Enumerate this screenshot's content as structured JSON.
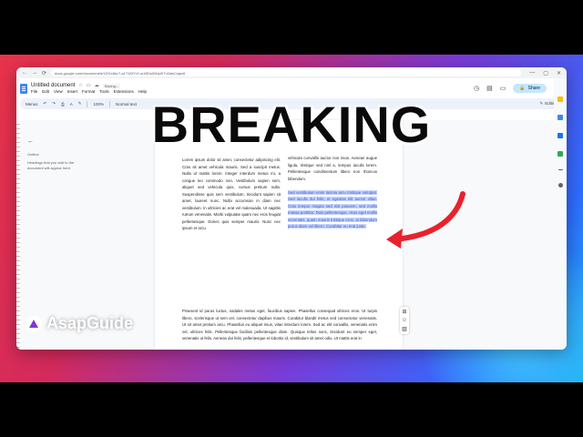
{
  "browser": {
    "url": "docs.google.com/document/d/1DGx8kcT-a1T1KfYrX-w1BDs00hjdXTvNdsCsjwdt",
    "nav_back": "←",
    "nav_forward": "→",
    "nav_reload": "⟳",
    "window_controls": [
      "—",
      "▢",
      "✕"
    ]
  },
  "doc": {
    "title": "Untitled document",
    "saving": "Saving...",
    "star": "☆",
    "move": "▭",
    "cloud": "☁",
    "menu": [
      "File",
      "Edit",
      "View",
      "Insert",
      "Format",
      "Tools",
      "Extensions",
      "Help"
    ],
    "history_icon": "◷",
    "comment_icon": "▤",
    "meet_icon": "▭",
    "share_label": "Share",
    "share_lock": "🔒"
  },
  "toolbar": {
    "menus": "Menus",
    "undo": "↶",
    "redo": "↷",
    "print": "⎙",
    "spell": "A",
    "paint": "✎",
    "zoom": "100%",
    "style": "Normal text",
    "editing": "Editing",
    "editing_icon": "✎"
  },
  "outline": {
    "back": "←",
    "label": "Outline",
    "hint": "Headings that you add to the document will appear here."
  },
  "page": {
    "left_col": "Lorem ipsum dolor sit amet, consectetur adipiscing elit. Cras sit amet vehicula mauris. Sed a suscipit metus. Nulla id mattis lorem. Integer interdum metus mi, a congue leo commodo non. Vestibulum sapien sem, aliquet sed vehicula quis, cursus pretium nulla. Suspendisse quis sem vestibulum, tincidunt sapien sit amet, laoreet nunc. Nulla accumsan in diam nec vestibulum. In ultricies ac erat vel malesuada. Ut sagittis rutrum venenatis. Morbi vulputate quam nec eros feugiat pellentesque. Donec quis semper mauris. Nunc nec ipsum et arcu",
    "right_col_plain": "vehicula convallis auctor non risus. Aenean augue ligula, tristique sed nisl a, tempus iaculis lorem. Pellentesque condimentum libero non rhoncus bibendum.",
    "right_col_highlight": "Sed vestibulum enim lacinia arcu tristique volutpat. Sed iaculis dui felis, et egestas elit auctor vitae. Cras tempor magna sed nisl posuere, sed mollis massa porttitor. Duis pellentesque, risus eget mollis venenatis, quam mauris tristique eros, at bibendum purus diam vel libero. Curabitur eu erat justo.",
    "full_para": "Praesent id purus luctus, sodales metus eget, faucibus sapien. Phasellus consequat ultrices eros. Ut turpis libero, scelerisque ut sem vel, consectetur dapibus mauris. Curabitur blandit metus sed consectetur venenatis. Ut sit amet pretium arcu. Phasellus eu aliquet risus, vitae interdum lorem. Sed ac elit convallis, venenatis enim vel, ultrices felis. Pellentesque facilisis pellentesque diam. Quisque tellus nunc, tincidunt eu semper eget, venenatis ut felis. Aenean dui felis, pellentesque et lobortis id, vestibulum sit amet odio. Ut mattis erat in"
  },
  "float_icons": [
    "⊞",
    "☺",
    "▨"
  ],
  "overlay": {
    "headline": "BREAKING",
    "logo_text": "AsapGuide"
  },
  "colors": {
    "accent": "#e8334a",
    "highlight": "#c6d5ff",
    "share": "#c2e7ff"
  }
}
